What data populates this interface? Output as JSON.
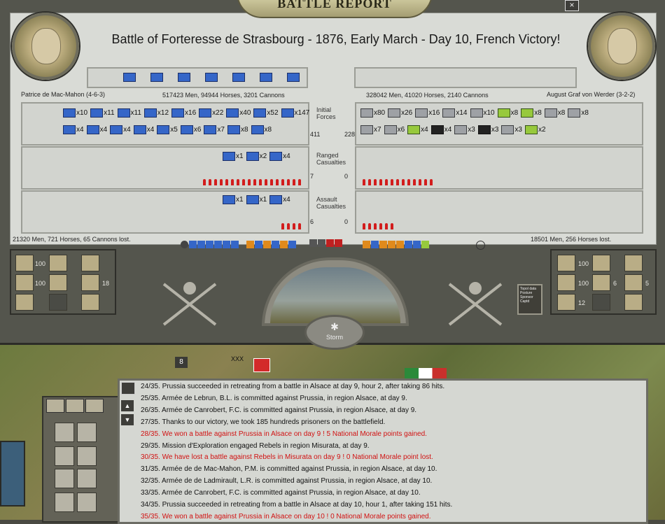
{
  "window": {
    "title": "BATTLE REPORT",
    "close_label": "×"
  },
  "battle": {
    "title": "Battle of Forteresse de Strasbourg - 1876, Early March - Day 10, French Victory!"
  },
  "left_side": {
    "commander": "Patrice de Mac-Mahon (4-6-3)",
    "force_summary": "517423 Men, 94944 Horses, 3201 Cannons",
    "losses": "21320 Men, 721 Horses, 65 Cannons lost.",
    "initial_count": "411",
    "ranged_count": "7",
    "assault_count": "6",
    "initial_units_row1": [
      "x10",
      "x11",
      "x11",
      "x12",
      "x16",
      "x22",
      "x40",
      "x52",
      "x147"
    ],
    "initial_units_row2": [
      "x4",
      "x4",
      "x4",
      "x4",
      "x5",
      "x6",
      "x7",
      "x8",
      "x8"
    ],
    "ranged_units": [
      "x1",
      "x2",
      "x4"
    ],
    "assault_units": [
      "x1",
      "x1",
      "x4"
    ],
    "ranged_arrows": 18,
    "assault_arrows": 4,
    "panel_values": [
      "100",
      "100",
      "18"
    ]
  },
  "right_side": {
    "commander": "August Graf von Werder (3-2-2)",
    "force_summary": "328042 Men, 41020 Horses, 2140 Cannons",
    "losses": "18501 Men, 256 Horses lost.",
    "initial_count": "228",
    "ranged_count": "0",
    "assault_count": "0",
    "initial_units_row1": [
      "x80",
      "x26",
      "x16",
      "x14",
      "x10",
      "x8",
      "x8",
      "x8",
      "x8"
    ],
    "initial_units_row2": [
      "x7",
      "x6",
      "x4",
      "x4",
      "x3",
      "x3",
      "x3",
      "x2"
    ],
    "ranged_arrows": 13,
    "assault_arrows": 6,
    "panel_values": [
      "100",
      "100",
      "6",
      "5",
      "12"
    ]
  },
  "labels": {
    "initial": "Initial Forces",
    "ranged": "Ranged Casualties",
    "assault": "Assault Casualties"
  },
  "weather": {
    "label": "Storm"
  },
  "legend": {
    "items": [
      "Topol data",
      "Posture",
      "Sponsor",
      "Captd"
    ]
  },
  "log": {
    "lines": [
      {
        "text": "24/35.  Prussia succeeded in retreating from a battle in Alsace at day 9, hour 2, after taking 86 hits.",
        "color": "black"
      },
      {
        "text": "25/35.  Armée de Lebrun, B.L. is committed against Prussia, in region Alsace, at day 9.",
        "color": "black"
      },
      {
        "text": "26/35.  Armée de Canrobert, F.C. is committed against Prussia, in region Alsace, at day 9.",
        "color": "black"
      },
      {
        "text": "27/35.  Thanks to our victory, we took 185 hundreds prisoners on the battlefield.",
        "color": "black"
      },
      {
        "text": "28/35.  We won a battle against Prussia in Alsace on day 9 ! 5 National Morale points gained.",
        "color": "red"
      },
      {
        "text": "29/35.  Mission d'Exploration engaged Rebels in region Misurata, at day 9.",
        "color": "black"
      },
      {
        "text": "30/35.  We have lost a battle against Rebels in Misurata on day 9 ! 0 National Morale point lost.",
        "color": "red"
      },
      {
        "text": "31/35.  Armée de de Mac-Mahon, P.M. is committed against Prussia, in region Alsace, at day 10.",
        "color": "black"
      },
      {
        "text": "32/35.  Armée de de Ladmirault, L.R. is committed against Prussia, in region Alsace, at day 10.",
        "color": "black"
      },
      {
        "text": "33/35.  Armée de Canrobert, F.C. is committed against Prussia, in region Alsace, at day 10.",
        "color": "black"
      },
      {
        "text": "34/35.  Prussia succeeded in retreating from a battle in Alsace at day 10, hour 1, after taking 151 hits.",
        "color": "black"
      },
      {
        "text": "35/35.  We won a battle against Prussia in Alsace on day 10 ! 0 National Morale points gained.",
        "color": "red"
      }
    ]
  },
  "map": {
    "badge": "8",
    "label": "XXX"
  },
  "colors": {
    "red_text": "#d11212",
    "unit_blue": "#3566c8"
  }
}
